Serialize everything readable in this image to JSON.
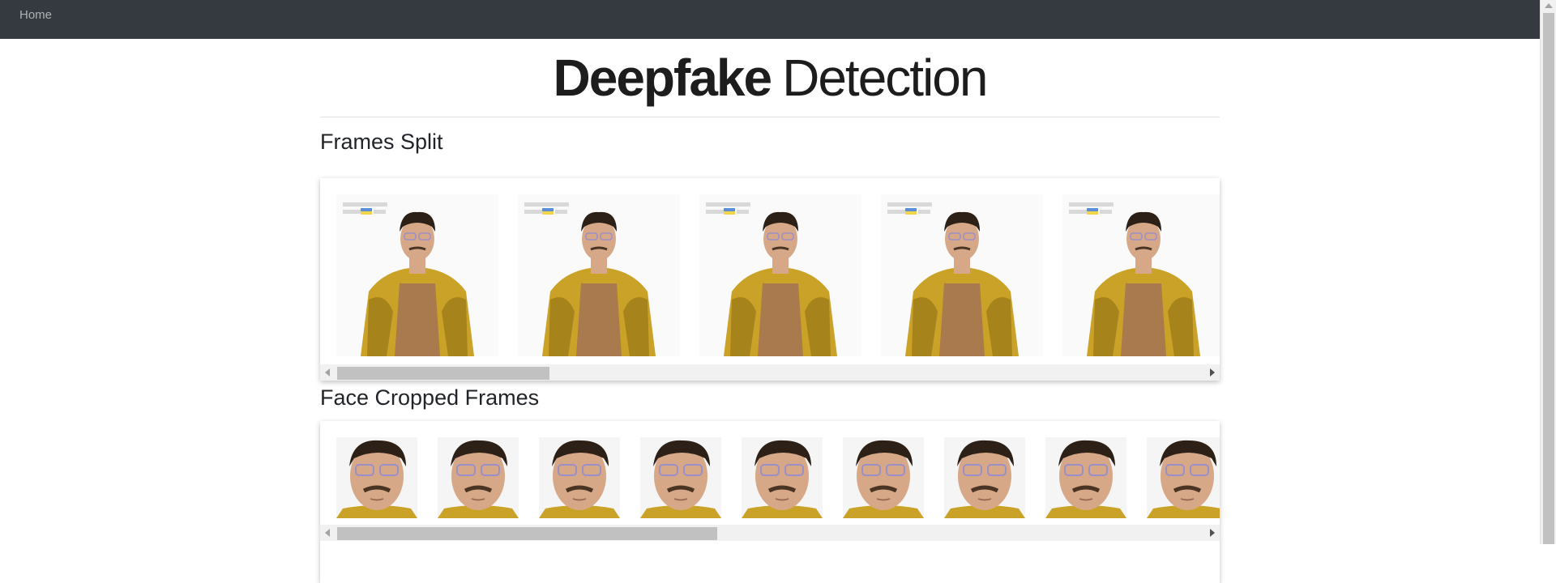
{
  "nav": {
    "home_label": "Home"
  },
  "header": {
    "title_bold": "Deepfake",
    "title_light": "Detection"
  },
  "sections": {
    "frames": {
      "heading": "Frames Split",
      "image_icon": "person-portrait-icon",
      "frame_count_visible": 5,
      "scroll_fraction": 0.24
    },
    "faces": {
      "heading": "Face Cropped Frames",
      "image_icon": "face-crop-icon",
      "frame_count_visible": 9,
      "scroll_fraction": 0.43
    }
  },
  "colors": {
    "navbar_bg": "#343a40",
    "scarf_yellow": "#c9a227",
    "scarf_dark": "#8b6a14",
    "shirt_brown": "#a97a4d",
    "skin": "#d7a887",
    "hair": "#2d2017"
  }
}
